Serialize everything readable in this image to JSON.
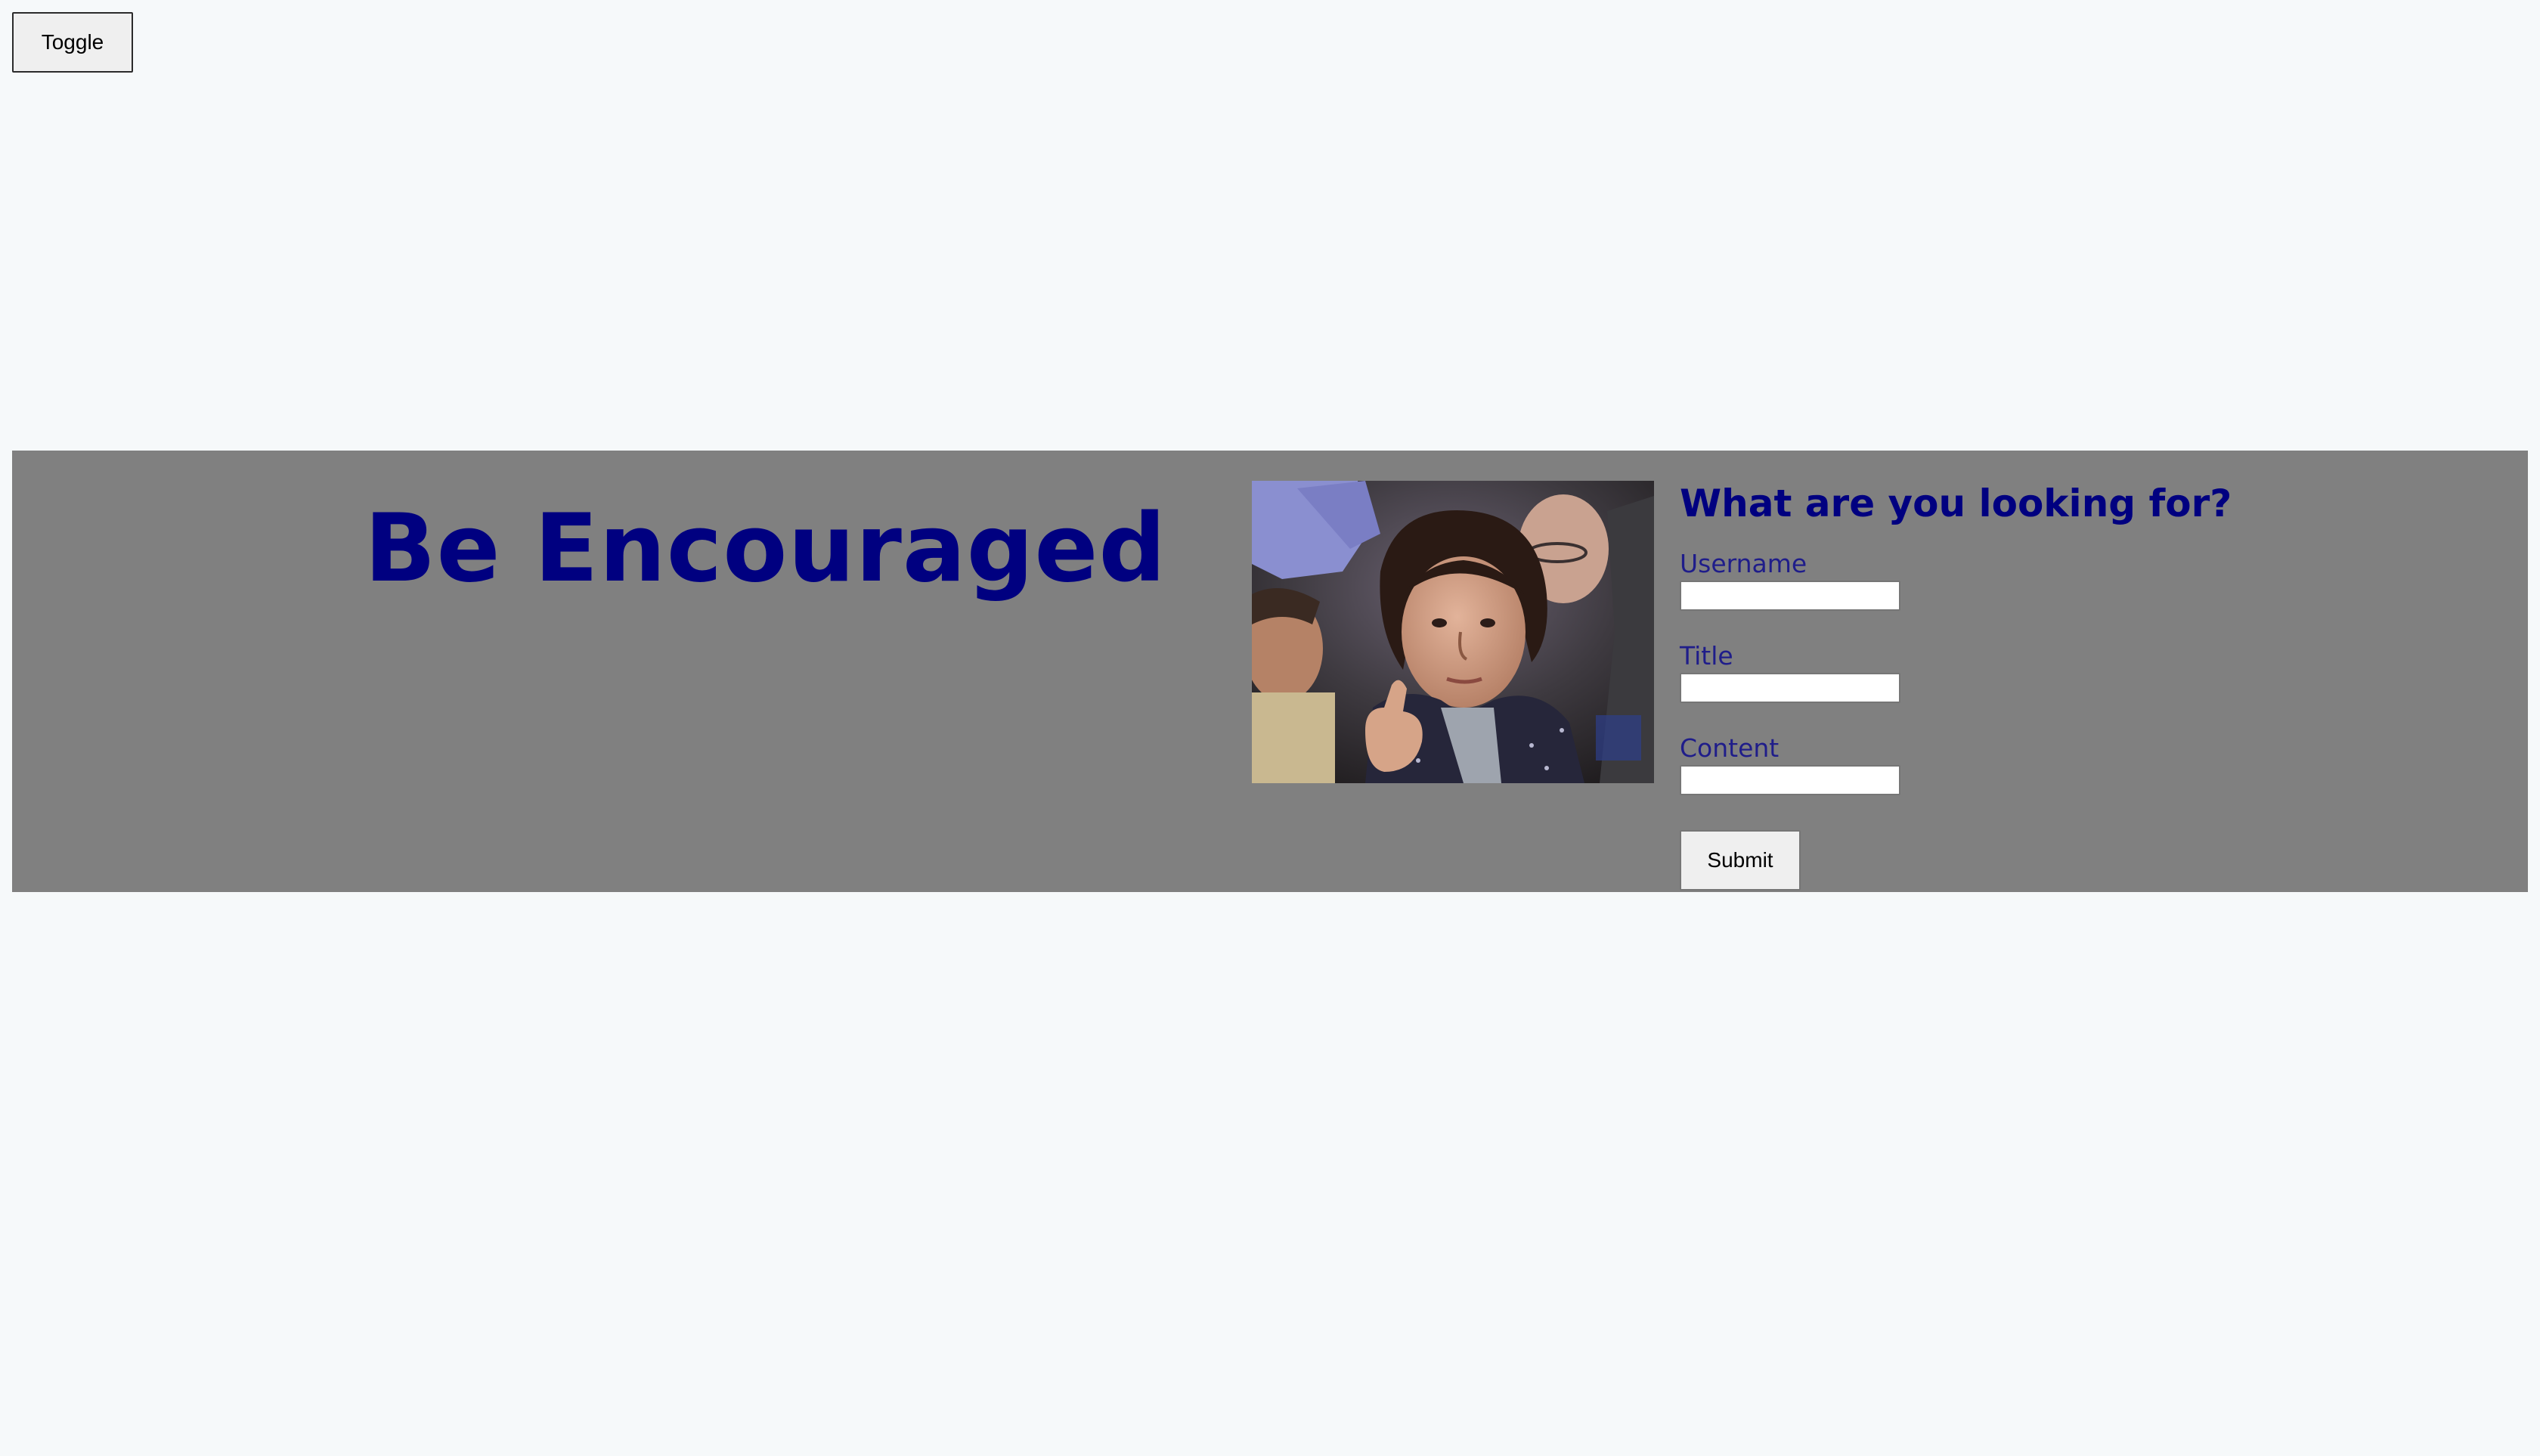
{
  "toggle": {
    "label": "Toggle"
  },
  "hero": {
    "title": "Be Encouraged",
    "image_alt": "boy-giving-thumbs-up-in-crowd"
  },
  "form": {
    "heading": "What are you looking for?",
    "fields": [
      {
        "label": "Username",
        "value": ""
      },
      {
        "label": "Title",
        "value": ""
      },
      {
        "label": "Content",
        "value": ""
      }
    ],
    "submit_label": "Submit"
  },
  "colors": {
    "page_background": "#f6f9fa",
    "banner_background": "#808080",
    "title_color": "#000080",
    "label_color": "#1f1d8a"
  }
}
